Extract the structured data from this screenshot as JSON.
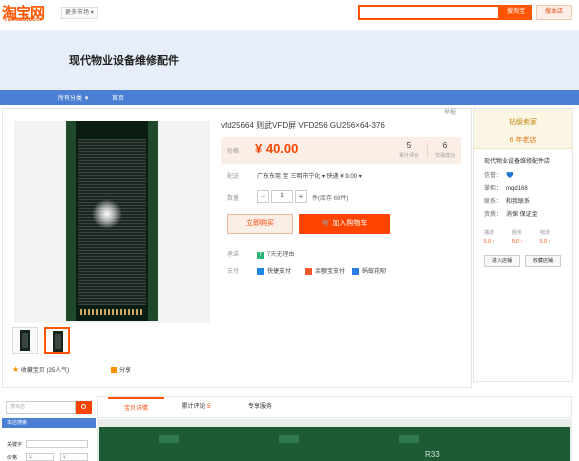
{
  "header": {
    "logo_cn": "淘宝网",
    "logo_en": "Taobao.com",
    "market_dropdown": "更多市场 ▾",
    "search_placeholder": "",
    "search_taobao_btn": "搜淘宝",
    "search_shop_btn": "搜本店"
  },
  "banner": {
    "shop_name": "现代物业设备维修配件"
  },
  "nav": {
    "all_categories": "所有分类 ▼",
    "home": "首页"
  },
  "product": {
    "report": "举报",
    "title": "vfd25664 则武VFD屏 VFD256 GU256×64-376",
    "price_label": "价格",
    "price_value": "¥ 40.00",
    "reviews_count": "5",
    "reviews_label": "累计评价",
    "trades_count": "6",
    "trades_label": "交易成功",
    "shipping_label": "配送",
    "shipping_text": "广东东莞 至 三明市宁化 ▾  快递 ¥ 9.00 ▾",
    "qty_label": "数量",
    "qty_minus": "−",
    "qty_value": "1",
    "qty_plus": "+",
    "stock_text": "件(库存 69件)",
    "buy_now": "立即购买",
    "add_cart": "🛒 加入购物车",
    "promise_label": "承诺",
    "promise_icon": "7",
    "promise_text": "7天无理由",
    "pay_label": "支付",
    "pay_methods": [
      "快捷支付",
      "余额宝支付",
      "蚂蚁花呗"
    ],
    "favorite": "收藏宝贝 (35人气)",
    "share": "分享"
  },
  "seller": {
    "header_title": "钻级卖家",
    "years": "6 年老店",
    "shop_name": "现代物业设备维修配件店",
    "credit_label": "信誉：",
    "credit_value": "💙",
    "seller_label": "掌柜：",
    "seller_value": "mqd168",
    "contact_label": "联系：",
    "contact_value": "和我联系",
    "quals_label": "资质：",
    "quals_value": "消保 保证金",
    "dsr": [
      {
        "label": "描述",
        "value": "5.0 ↑"
      },
      {
        "label": "服务",
        "value": "5.0 ↑"
      },
      {
        "label": "物流",
        "value": "5.0 ↑"
      }
    ],
    "enter_shop": "进入店铺",
    "fav_shop": "收藏店铺"
  },
  "sidebar": {
    "search_placeholder": "搜本店",
    "title": "本店搜索",
    "keyword_label": "关键字",
    "price_label": "价格",
    "price_from": "¥",
    "price_to": "¥"
  },
  "tabs": {
    "detail": "宝贝详情",
    "reviews": "累计评论",
    "reviews_count": "5",
    "service": "专享服务"
  },
  "detail_text": "R33"
}
